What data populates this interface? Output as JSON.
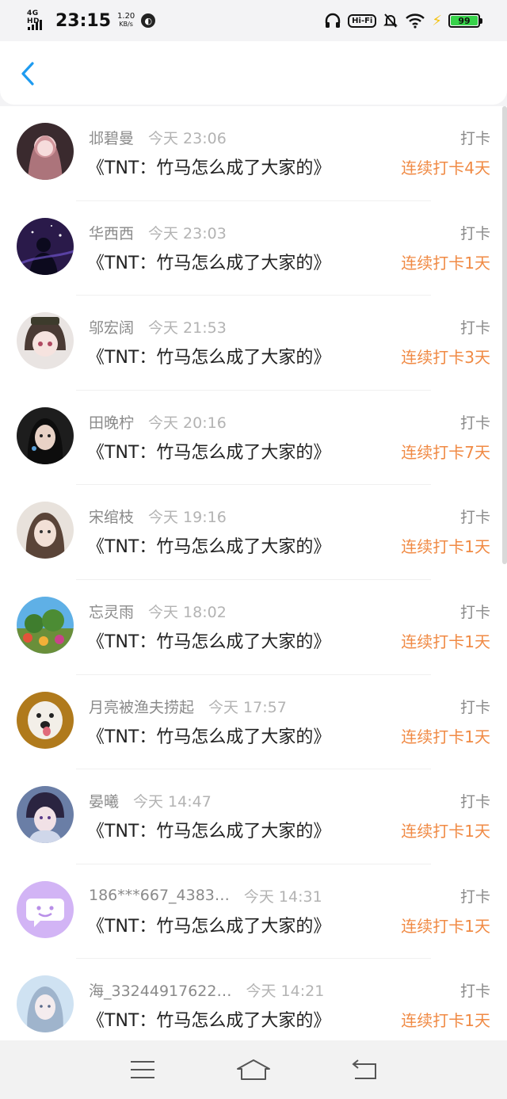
{
  "status_bar": {
    "network": "4G HD",
    "time": "23:15",
    "speed_value": "1.20",
    "speed_unit": "KB/s",
    "wifi_label": "Hi-Fi",
    "battery_level": "99",
    "battery_fraction": 0.99,
    "battery_color": "#37d24a"
  },
  "header": {
    "back_icon": "chevron-left-icon",
    "accent": "#1e9bf0"
  },
  "entries": [
    {
      "user": "邶碧曼",
      "time": "今天 23:06",
      "title": "《TNT：竹马怎么成了大家的》",
      "tag": "打卡",
      "streak": "连续打卡4天"
    },
    {
      "user": "华西西",
      "time": "今天 23:03",
      "title": "《TNT：竹马怎么成了大家的》",
      "tag": "打卡",
      "streak": "连续打卡1天"
    },
    {
      "user": "邬宏阔",
      "time": "今天 21:53",
      "title": "《TNT：竹马怎么成了大家的》",
      "tag": "打卡",
      "streak": "连续打卡3天"
    },
    {
      "user": "田晚柠",
      "time": "今天 20:16",
      "title": "《TNT：竹马怎么成了大家的》",
      "tag": "打卡",
      "streak": "连续打卡7天"
    },
    {
      "user": "宋绾枝",
      "time": "今天 19:16",
      "title": "《TNT：竹马怎么成了大家的》",
      "tag": "打卡",
      "streak": "连续打卡1天"
    },
    {
      "user": "忘灵雨",
      "time": "今天 18:02",
      "title": "《TNT：竹马怎么成了大家的》",
      "tag": "打卡",
      "streak": "连续打卡1天"
    },
    {
      "user": "月亮被渔夫捞起",
      "time": "今天 17:57",
      "title": "《TNT：竹马怎么成了大家的》",
      "tag": "打卡",
      "streak": "连续打卡1天"
    },
    {
      "user": "晏曦",
      "time": "今天 14:47",
      "title": "《TNT：竹马怎么成了大家的》",
      "tag": "打卡",
      "streak": "连续打卡1天"
    },
    {
      "user": "186***667_4383…",
      "time": "今天 14:31",
      "title": "《TNT：竹马怎么成了大家的》",
      "tag": "打卡",
      "streak": "连续打卡1天"
    },
    {
      "user": "海_33244917622…",
      "time": "今天 14:21",
      "title": "《TNT：竹马怎么成了大家的》",
      "tag": "打卡",
      "streak": "连续打卡1天"
    }
  ],
  "colors": {
    "streak": "#f08a44",
    "meta": "#8a8a8a",
    "title": "#222222"
  },
  "nav_bar": {
    "menu_icon": "menu-icon",
    "home_icon": "home-icon",
    "back_icon": "back-arrow-icon"
  }
}
